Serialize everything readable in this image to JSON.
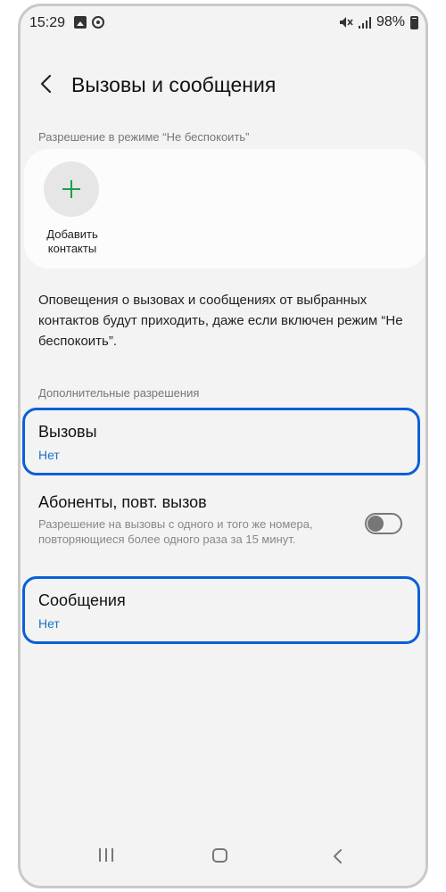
{
  "status_bar": {
    "time": "15:29",
    "battery": "98%"
  },
  "header": {
    "title": "Вызовы и сообщения"
  },
  "dnd_section": {
    "label": "Разрешение в режиме “Не беспокоить”",
    "add_contacts_line1": "Добавить",
    "add_contacts_line2": "контакты"
  },
  "info_text": "Оповещения о вызовах и сообщениях от выбранных контактов будут приходить, даже если включен режим “Не беспокоить”.",
  "extra_section": {
    "label": "Дополнительные разрешения",
    "items": [
      {
        "title": "Вызовы",
        "value": "Нет"
      },
      {
        "title": "Абоненты, повт. вызов",
        "subtitle": "Разрешение на вызовы с одного и того же номера, повторяющиеся более одного раза за 15 минут.",
        "toggle_on": false
      },
      {
        "title": "Сообщения",
        "value": "Нет"
      }
    ]
  },
  "colors": {
    "accent_blue": "#1a73c8",
    "highlight_border": "#0a5fd8",
    "add_green": "#1e9e4a",
    "background": "#f3f3f3"
  },
  "icons": [
    "gallery-icon",
    "circle-status-icon",
    "mute-icon",
    "signal-icon",
    "battery-icon",
    "back-arrow-icon",
    "plus-icon",
    "recent-apps-icon",
    "home-icon",
    "nav-back-icon"
  ]
}
